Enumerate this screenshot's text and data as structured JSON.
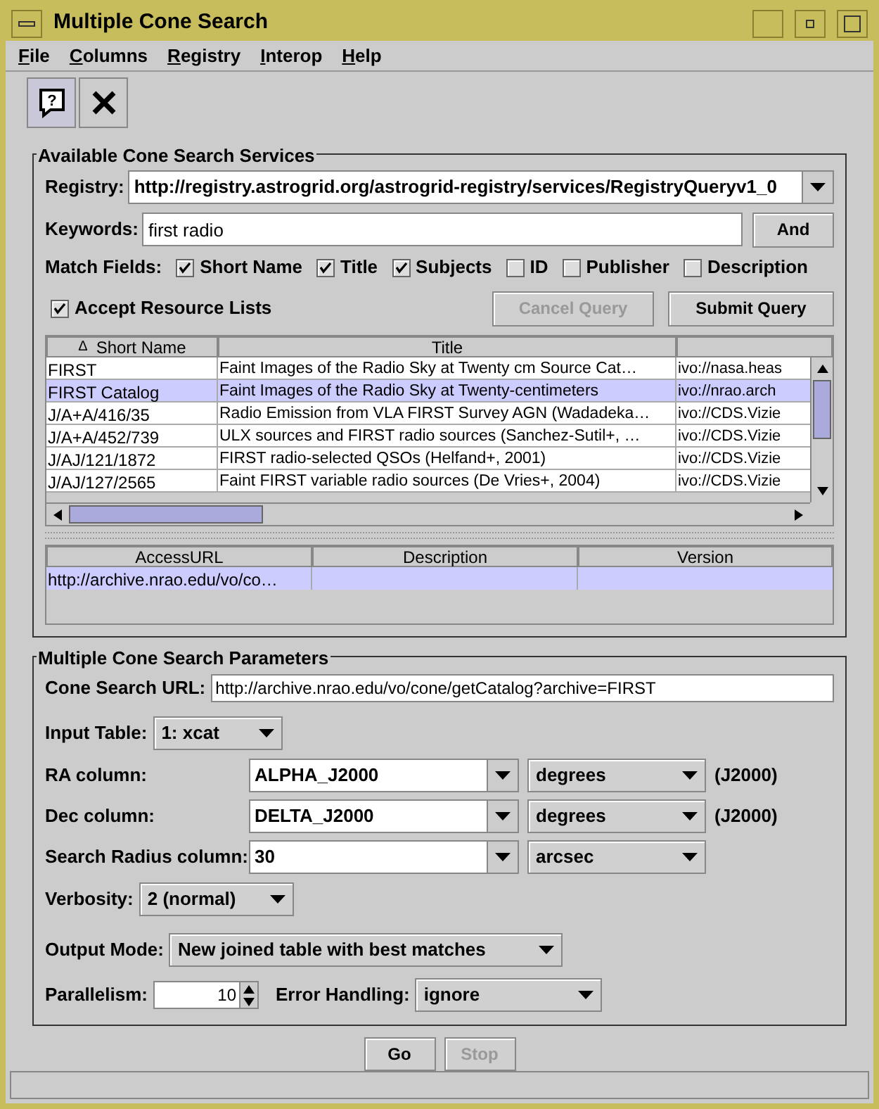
{
  "window": {
    "title": "Multiple Cone Search"
  },
  "menu": [
    "File",
    "Columns",
    "Registry",
    "Interop",
    "Help"
  ],
  "toolbar": {
    "help_glyph": "?"
  },
  "services": {
    "legend": "Available Cone Search Services",
    "registry_label": "Registry:",
    "registry_value": "http://registry.astrogrid.org/astrogrid-registry/services/RegistryQueryv1_0",
    "keywords_label": "Keywords:",
    "keywords_value": "first radio",
    "and_button": "And",
    "match_label": "Match Fields:",
    "match_fields": [
      {
        "label": "Short Name",
        "checked": true
      },
      {
        "label": "Title",
        "checked": true
      },
      {
        "label": "Subjects",
        "checked": true
      },
      {
        "label": "ID",
        "checked": false
      },
      {
        "label": "Publisher",
        "checked": false
      },
      {
        "label": "Description",
        "checked": false
      }
    ],
    "accept_resource_lists": {
      "label": "Accept Resource Lists",
      "checked": true
    },
    "cancel_button": {
      "label": "Cancel Query",
      "disabled": true
    },
    "submit_button": {
      "label": "Submit Query",
      "disabled": false
    },
    "table": {
      "sort_mark": "Δ",
      "columns": [
        "Short Name",
        "Title"
      ],
      "rows": [
        {
          "short_name": "FIRST",
          "title": "Faint Images of the Radio Sky at Twenty cm Source Cat…",
          "column_3": "ivo://nasa.heas",
          "selected": false
        },
        {
          "short_name": "FIRST Catalog",
          "title": "Faint Images of the Radio Sky at Twenty-centimeters",
          "column_3": "ivo://nrao.arch",
          "selected": true
        },
        {
          "short_name": "J/A+A/416/35",
          "title": "Radio Emission from VLA FIRST Survey AGN (Wadadeka…",
          "column_3": "ivo://CDS.Vizie",
          "selected": false
        },
        {
          "short_name": "J/A+A/452/739",
          "title": "ULX sources and FIRST radio sources (Sanchez-Sutil+, …",
          "column_3": "ivo://CDS.Vizie",
          "selected": false
        },
        {
          "short_name": "J/AJ/121/1872",
          "title": "FIRST radio-selected QSOs (Helfand+, 2001)",
          "column_3": "ivo://CDS.Vizie",
          "selected": false
        },
        {
          "short_name": "J/AJ/127/2565",
          "title": "Faint FIRST variable radio sources (De Vries+, 2004)",
          "column_3": "ivo://CDS.Vizie",
          "selected": false
        }
      ]
    },
    "detail_table": {
      "columns": [
        "AccessURL",
        "Description",
        "Version"
      ],
      "rows": [
        {
          "access_url": "http://archive.nrao.edu/vo/co…",
          "selected": true
        }
      ]
    }
  },
  "parameters": {
    "legend": "Multiple Cone Search Parameters",
    "url_label": "Cone Search URL:",
    "url_value": "http://archive.nrao.edu/vo/cone/getCatalog?archive=FIRST",
    "input_table_label": "Input Table:",
    "input_table_value": "1: xcat",
    "columns": [
      {
        "label": "RA column:",
        "value": "ALPHA_J2000",
        "unit": "degrees",
        "note": "(J2000)"
      },
      {
        "label": "Dec column:",
        "value": "DELTA_J2000",
        "unit": "degrees",
        "note": "(J2000)"
      },
      {
        "label": "Search Radius column:",
        "value": "30",
        "unit": "arcsec"
      }
    ],
    "verbosity_label": "Verbosity:",
    "verbosity_value": "2 (normal)",
    "output_mode_label": "Output Mode:",
    "output_mode_value": "New joined table with best matches",
    "parallelism_label": "Parallelism:",
    "parallelism_value": "10",
    "error_label": "Error Handling:",
    "error_value": "ignore"
  },
  "actions": [
    {
      "label": "Go",
      "disabled": false
    },
    {
      "label": "Stop",
      "disabled": true
    }
  ]
}
